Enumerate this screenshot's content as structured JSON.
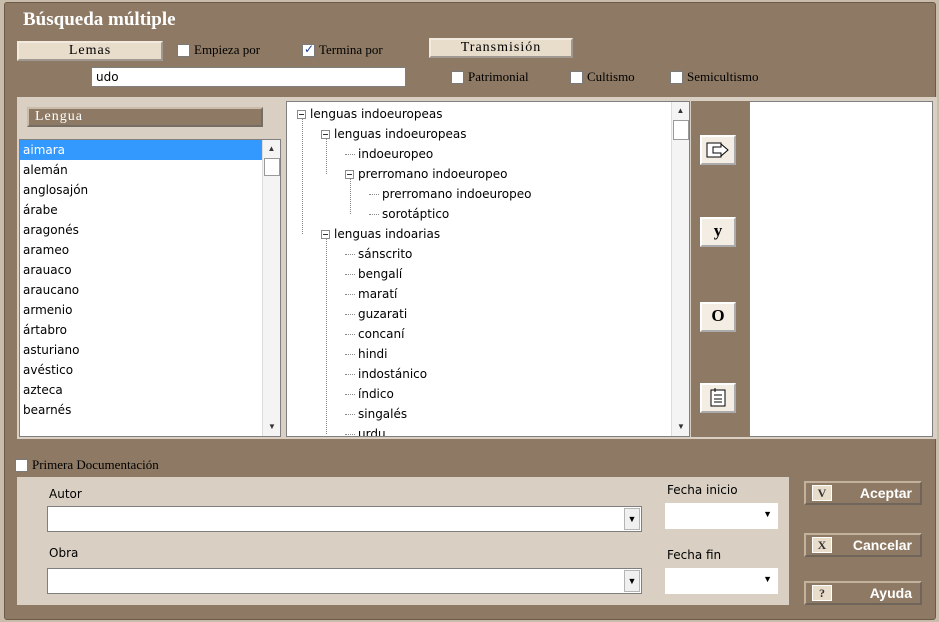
{
  "window": {
    "title": "Búsqueda múltiple"
  },
  "lemas": {
    "header": "Lemas",
    "starts_with": {
      "label": "Empieza por",
      "checked": false
    },
    "ends_with": {
      "label": "Termina por",
      "checked": true
    },
    "input_value": "udo"
  },
  "transmision": {
    "header": "Transmisión",
    "options": [
      {
        "label": "Patrimonial",
        "checked": false
      },
      {
        "label": "Cultismo",
        "checked": false
      },
      {
        "label": "Semicultismo",
        "checked": false
      }
    ]
  },
  "lengua": {
    "header": "Lengua",
    "items": [
      "aimara",
      "alemán",
      "anglosajón",
      "árabe",
      "aragonés",
      "arameo",
      "arauaco",
      "araucano",
      "armenio",
      "ártabro",
      "asturiano",
      "avéstico",
      "azteca",
      "bearnés"
    ],
    "selected_index": 0
  },
  "tree": {
    "nodes": [
      {
        "label": "lenguas indoeuropeas",
        "level": 0,
        "expandable": true
      },
      {
        "label": "lenguas indoeuropeas",
        "level": 1,
        "expandable": true
      },
      {
        "label": "indoeuropeo",
        "level": 2,
        "expandable": false
      },
      {
        "label": "prerromano indoeuropeo",
        "level": 2,
        "expandable": true
      },
      {
        "label": "prerromano indoeuropeo",
        "level": 3,
        "expandable": false
      },
      {
        "label": "sorotáptico",
        "level": 3,
        "expandable": false
      },
      {
        "label": "lenguas indoarias",
        "level": 1,
        "expandable": true
      },
      {
        "label": "sánscrito",
        "level": 2,
        "expandable": false
      },
      {
        "label": "bengalí",
        "level": 2,
        "expandable": false
      },
      {
        "label": "maratí",
        "level": 2,
        "expandable": false
      },
      {
        "label": "guzarati",
        "level": 2,
        "expandable": false
      },
      {
        "label": "concaní",
        "level": 2,
        "expandable": false
      },
      {
        "label": "hindi",
        "level": 2,
        "expandable": false
      },
      {
        "label": "indostánico",
        "level": 2,
        "expandable": false
      },
      {
        "label": "índico",
        "level": 2,
        "expandable": false
      },
      {
        "label": "singalés",
        "level": 2,
        "expandable": false
      },
      {
        "label": "urdu",
        "level": 2,
        "expandable": false
      }
    ]
  },
  "tools": {
    "add_icon": "export-arrow-icon",
    "and_label": "y",
    "or_label": "O",
    "clear_icon": "clear-document-icon"
  },
  "primera_documentacion": {
    "label": "Primera Documentación",
    "checked": false,
    "autor_label": "Autor",
    "autor_value": "",
    "obra_label": "Obra",
    "obra_value": "",
    "fecha_inicio_label": "Fecha inicio",
    "fecha_inicio_value": "",
    "fecha_fin_label": "Fecha fin",
    "fecha_fin_value": ""
  },
  "buttons": {
    "accept": {
      "key": "V",
      "label": "Aceptar"
    },
    "cancel": {
      "key": "X",
      "label": "Cancelar"
    },
    "help": {
      "key": "?",
      "label": "Ayuda"
    }
  },
  "colors": {
    "frame": "#8e7a64",
    "panel": "#d9d0c3",
    "selection": "#3399ff"
  }
}
